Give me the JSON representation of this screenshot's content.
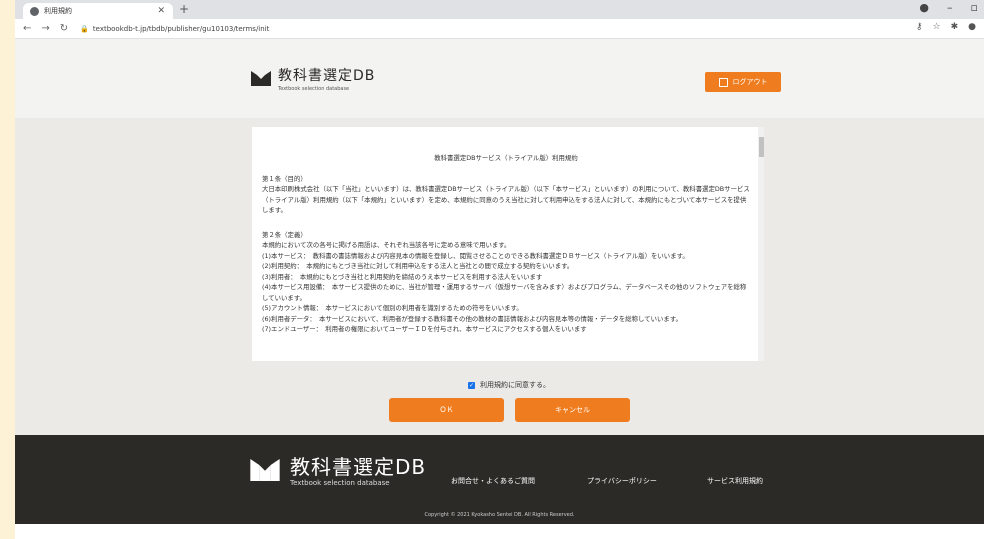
{
  "browser": {
    "tab_title": "利用規約",
    "url": "textbookdb-t.jp/tbdb/publisher/gu10103/terms/init"
  },
  "header": {
    "logo_ja": "教科書選定DB",
    "logo_en": "Textbook selection database",
    "logout_label": "ログアウト"
  },
  "terms": {
    "title": "教科書選定DBサービス（トライアル版）利用規約",
    "paragraphs": [
      "第１条（目的）",
      "大日本印刷株式会社（以下「当社」といいます）は、教科書選定DBサービス（トライアル版）（以下「本サービス」といいます）の利用について、教科書選定DBサービス（トライアル版）利用規約（以下「本規約」といいます）を定め、本規約に同意のうえ当社に対して利用申込をする法人に対して、本規約にもとづいて本サービスを提供します。",
      "",
      "第２条（定義）",
      "本規約において次の各号に掲げる用語は、それぞれ当該各号に定める意味で用います。",
      "(1)本サービス：　教科書の書誌情報および内容見本の情報を登録し、閲覧させることのできる教科書選定ＤＢサービス（トライアル版）をいいます。",
      "(2)利用契約：　本規約にもとづき当社に対して利用申込をする法人と当社との間で成立する契約をいいます。",
      "(3)利用者：　本規約にもとづき当社と利用契約を締結のうえ本サービスを利用する法人をいいます",
      "(4)本サービス用設備：　本サービス提供のために、当社が管理・運用するサーバ（仮想サーバを含みます）およびプログラム、データベースその他のソフトウェアを総称していいます。",
      "(5)アカウント情報：　本サービスにおいて個別の利用者を識別するための符号をいいます。",
      "(6)利用者データ：　本サービスにおいて、利用者が登録する教科書その他の教材の書誌情報および内容見本等の情報・データを総称していいます。",
      "(7)エンドユーザー：　利用者の権限においてユーザーＩＤを付与され、本サービスにアクセスする個人をいいます"
    ]
  },
  "agree_label": "利用規約に同意する。",
  "ok_label": "ＯＫ",
  "cancel_label": "キャンセル",
  "footer": {
    "logo_ja": "教科書選定DB",
    "logo_en": "Textbook selection database",
    "links": [
      "お問合せ・よくあるご質問",
      "プライバシーポリシー",
      "サービス利用規約"
    ],
    "copyright": "Copyright © 2021 Kyokasho Sentei DB. All Rights Reserved."
  }
}
